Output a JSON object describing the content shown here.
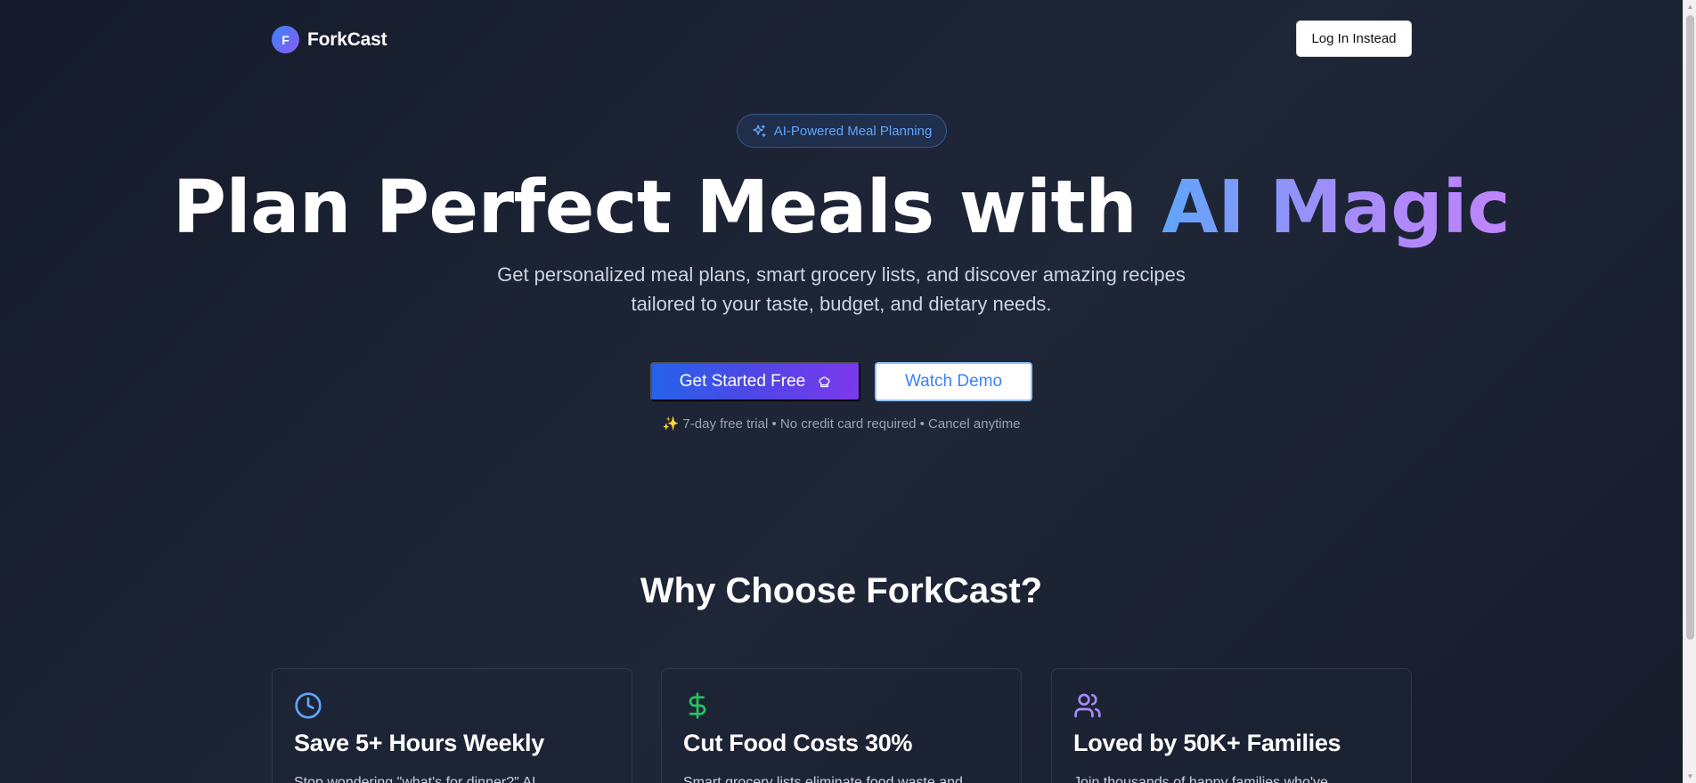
{
  "header": {
    "logo_initial": "F",
    "logo_text": "ForkCast",
    "login_label": "Log In Instead"
  },
  "hero": {
    "badge_label": "AI-Powered Meal Planning",
    "title_main": "Plan Perfect Meals with ",
    "title_accent": "AI Magic",
    "subtitle_line1": "Get personalized meal plans, smart grocery lists, and discover amazing recipes",
    "subtitle_line2": "tailored to your taste, budget, and dietary needs.",
    "cta_primary_label": "Get Started Free",
    "cta_secondary_label": "Watch Demo",
    "trial_note": "✨ 7-day free trial • No credit card required • Cancel anytime"
  },
  "features": {
    "section_title": "Why Choose ForkCast?",
    "cards": [
      {
        "icon": "clock-icon",
        "title": "Save 5+ Hours Weekly",
        "description": "Stop wondering \"what's for dinner?\" AI"
      },
      {
        "icon": "dollar-icon",
        "title": "Cut Food Costs 30%",
        "description": "Smart grocery lists eliminate food waste and"
      },
      {
        "icon": "users-icon",
        "title": "Loved by 50K+ Families",
        "description": "Join thousands of happy families who've"
      }
    ]
  },
  "colors": {
    "background": "#1c2334",
    "accent_blue": "#60a5fa",
    "accent_purple": "#a78bfa",
    "icon_green": "#22c55e",
    "icon_purple": "#a78bfa",
    "primary_gradient_start": "#2563eb",
    "primary_gradient_end": "#7c3aed"
  }
}
